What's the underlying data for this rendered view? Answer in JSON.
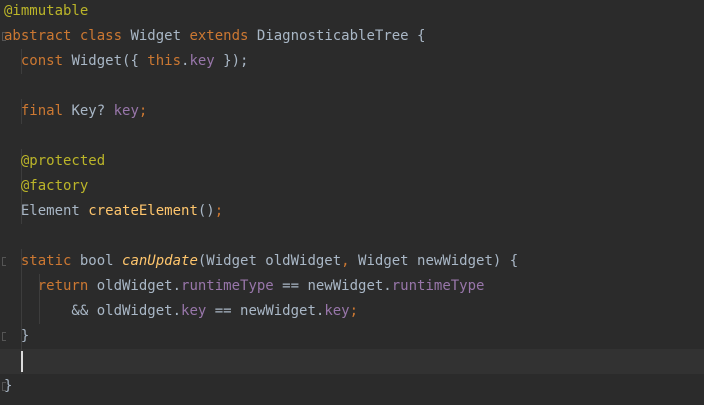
{
  "editor": {
    "language": "dart",
    "colors": {
      "background": "#2b2b2b",
      "current_line": "#323232",
      "keyword": "#cc7832",
      "annotation": "#bbb529",
      "field": "#9876aa",
      "function": "#ffc66d",
      "text": "#a9b7c6"
    },
    "lines": [
      {
        "tokens": [
          {
            "t": "@immutable",
            "c": "ann"
          }
        ]
      },
      {
        "tokens": [
          {
            "t": "abstract class ",
            "c": "kw"
          },
          {
            "t": "Widget ",
            "c": "ident"
          },
          {
            "t": "extends ",
            "c": "kw"
          },
          {
            "t": "DiagnosticableTree {",
            "c": "ident"
          }
        ]
      },
      {
        "tokens": [
          {
            "t": "  const ",
            "c": "kw"
          },
          {
            "t": "Widget({ ",
            "c": "ident"
          },
          {
            "t": "this",
            "c": "kw"
          },
          {
            "t": ".",
            "c": "ident"
          },
          {
            "t": "key",
            "c": "field"
          },
          {
            "t": " });",
            "c": "ident"
          }
        ]
      },
      {
        "tokens": []
      },
      {
        "tokens": [
          {
            "t": "  final ",
            "c": "kw"
          },
          {
            "t": "Key? ",
            "c": "ident"
          },
          {
            "t": "key",
            "c": "field"
          },
          {
            "t": ";",
            "c": "kw"
          }
        ]
      },
      {
        "tokens": []
      },
      {
        "tokens": [
          {
            "t": "  @protected",
            "c": "ann"
          }
        ]
      },
      {
        "tokens": [
          {
            "t": "  @factory",
            "c": "ann"
          }
        ]
      },
      {
        "tokens": [
          {
            "t": "  Element ",
            "c": "ident"
          },
          {
            "t": "createElement",
            "c": "fn"
          },
          {
            "t": "()",
            "c": "ident"
          },
          {
            "t": ";",
            "c": "kw"
          }
        ]
      },
      {
        "tokens": []
      },
      {
        "tokens": [
          {
            "t": "  static ",
            "c": "kw"
          },
          {
            "t": "bool ",
            "c": "ident"
          },
          {
            "t": "canUpdate",
            "c": "fn-italic"
          },
          {
            "t": "(Widget oldWidget",
            "c": "ident"
          },
          {
            "t": ", ",
            "c": "kw"
          },
          {
            "t": "Widget newWidget) {",
            "c": "ident"
          }
        ]
      },
      {
        "tokens": [
          {
            "t": "    return ",
            "c": "kw"
          },
          {
            "t": "oldWidget.",
            "c": "ident"
          },
          {
            "t": "runtimeType",
            "c": "field"
          },
          {
            "t": " == newWidget.",
            "c": "ident"
          },
          {
            "t": "runtimeType",
            "c": "field"
          }
        ]
      },
      {
        "tokens": [
          {
            "t": "        && oldWidget.",
            "c": "ident"
          },
          {
            "t": "key",
            "c": "field"
          },
          {
            "t": " == newWidget.",
            "c": "ident"
          },
          {
            "t": "key",
            "c": "field"
          },
          {
            "t": ";",
            "c": "kw"
          }
        ]
      },
      {
        "tokens": [
          {
            "t": "  }",
            "c": "ident"
          }
        ]
      },
      {
        "tokens": []
      },
      {
        "tokens": [
          {
            "t": "}",
            "c": "ident"
          }
        ]
      }
    ]
  }
}
